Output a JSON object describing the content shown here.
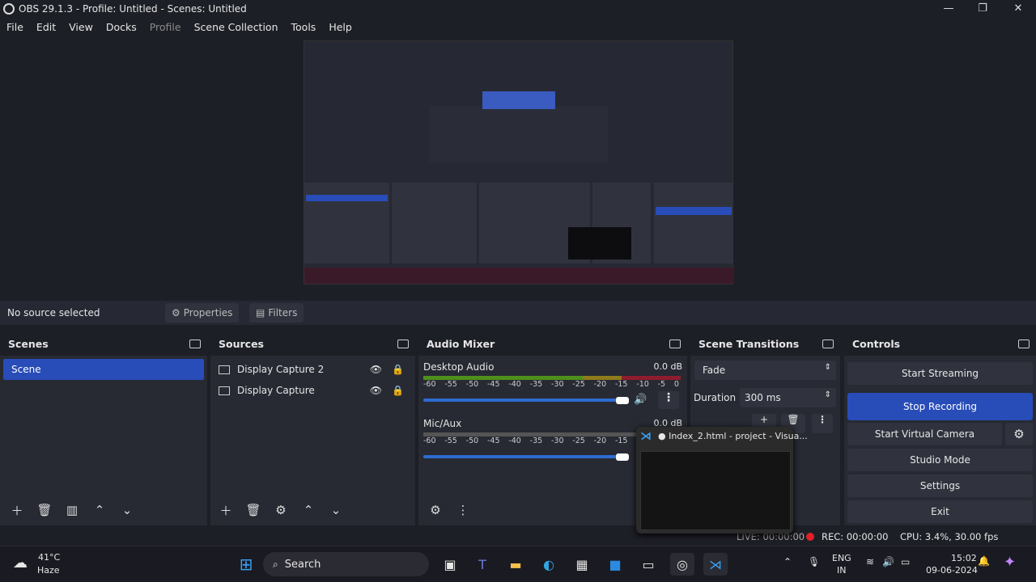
{
  "window": {
    "title": "OBS 29.1.3 - Profile: Untitled - Scenes: Untitled",
    "minimize": "—",
    "maximize": "❐",
    "close": "✕"
  },
  "menu": [
    "File",
    "Edit",
    "View",
    "Docks",
    "Profile",
    "Scene Collection",
    "Tools",
    "Help"
  ],
  "source_bar": {
    "status": "No source selected",
    "properties": "Properties",
    "filters": "Filters"
  },
  "scenes": {
    "title": "Scenes",
    "items": [
      "Scene"
    ]
  },
  "sources": {
    "title": "Sources",
    "items": [
      "Display Capture 2",
      "Display Capture"
    ]
  },
  "audio": {
    "title": "Audio Mixer",
    "channels": [
      {
        "name": "Desktop Audio",
        "level": "0.0 dB",
        "volume": 1.0
      },
      {
        "name": "Mic/Aux",
        "level": "0.0 dB",
        "volume": 1.0
      }
    ],
    "ticks": [
      "-60",
      "-55",
      "-50",
      "-45",
      "-40",
      "-35",
      "-30",
      "-25",
      "-20",
      "-15",
      "-10",
      "-5",
      "0"
    ]
  },
  "transitions": {
    "title": "Scene Transitions",
    "type": "Fade",
    "duration_label": "Duration",
    "duration": "300 ms"
  },
  "controls": {
    "title": "Controls",
    "buttons": [
      "Start Streaming",
      "Stop Recording",
      "Start Virtual Camera",
      "Studio Mode",
      "Settings",
      "Exit"
    ]
  },
  "status": {
    "live": "LIVE: 00:00:00",
    "rec": "REC: 00:00:00",
    "cpu": "CPU: 3.4%, 30.00 fps"
  },
  "popup": {
    "title": "● Index_2.html - project - Visua..."
  },
  "taskbar": {
    "weather_temp": "41°C",
    "weather_desc": "Haze",
    "search": "Search",
    "lang1": "ENG",
    "lang2": "IN",
    "time": "15:02",
    "date": "09-06-2024"
  },
  "colors": {
    "accent": "#284cb8",
    "rec": "#e0202a"
  }
}
